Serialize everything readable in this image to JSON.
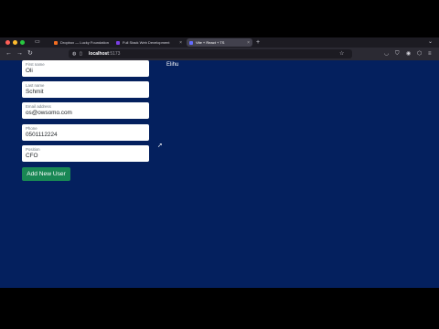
{
  "browser": {
    "tabs": [
      {
        "label": "Dropbox — Lucky Foundation",
        "active": false,
        "favicon_color": "#f36d21"
      },
      {
        "label": "Full Stack Web Development",
        "active": false,
        "favicon_color": "#7b3fe4"
      },
      {
        "label": "Vite + React + TS",
        "active": true,
        "favicon_color": "#646cff"
      }
    ],
    "new_tab_icon": "plus-icon",
    "tab_list_icon": "chevron-down-icon",
    "url": {
      "host": "localhost",
      "port": ":5173"
    },
    "nav_icons": [
      "back-arrow-icon",
      "forward-arrow-icon",
      "reload-icon"
    ],
    "right_icons": [
      "pocket-icon",
      "shield-icon",
      "download-icon",
      "account-icon",
      "extensions-icon",
      "menu-icon"
    ]
  },
  "form": {
    "fields": [
      {
        "label": "First name",
        "value": "Oli"
      },
      {
        "label": "Last name",
        "value": "Schmit"
      },
      {
        "label": "Email address",
        "value": "os@owsomo.com"
      },
      {
        "label": "Phone",
        "value": "0501112224"
      },
      {
        "label": "Position",
        "value": "CFO"
      }
    ],
    "submit_label": "Add New User"
  },
  "user_list": {
    "items": [
      "Elihu"
    ]
  },
  "colors": {
    "page_background": "#04205e",
    "button": "#198754",
    "tab_bar": "#1c1b22",
    "nav_bar": "#2b2a33"
  }
}
